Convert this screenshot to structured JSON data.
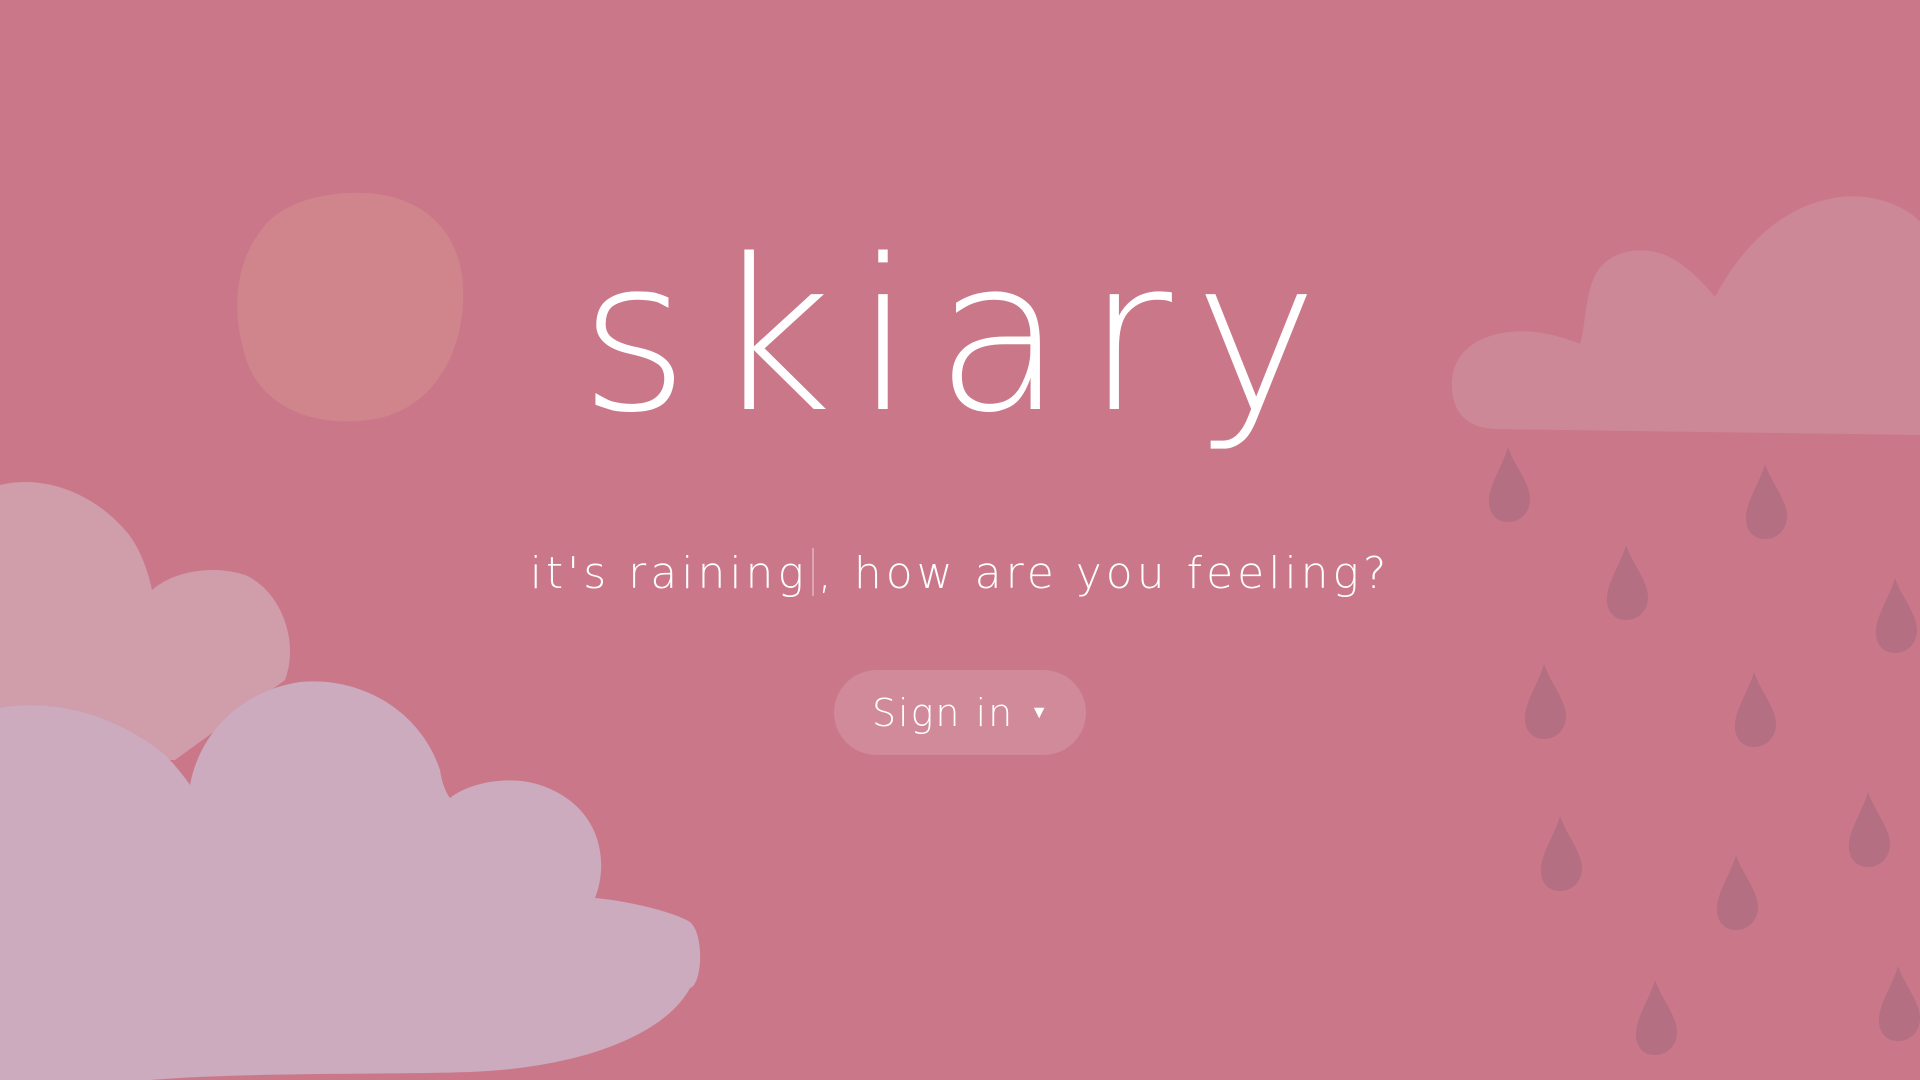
{
  "brand": {
    "logo_text": "skiary"
  },
  "hero": {
    "tagline_before": "it's raining",
    "tagline_after": ", how are you feeling?"
  },
  "actions": {
    "signin_label": "Sign in",
    "signin_arrow": "▼"
  },
  "colors": {
    "background": "#ca7889",
    "sun": "#d0858c",
    "cloud_right": "#cd8898",
    "cloud_left_back": "#d09dab",
    "cloud_left_front": "#cbabbd",
    "raindrop": "#b56f82",
    "text": "#ffffff"
  },
  "icons": {
    "sun": "sun-icon",
    "cloud": "cloud-icon",
    "raindrop": "raindrop-icon",
    "dropdown": "caret-down-icon"
  }
}
